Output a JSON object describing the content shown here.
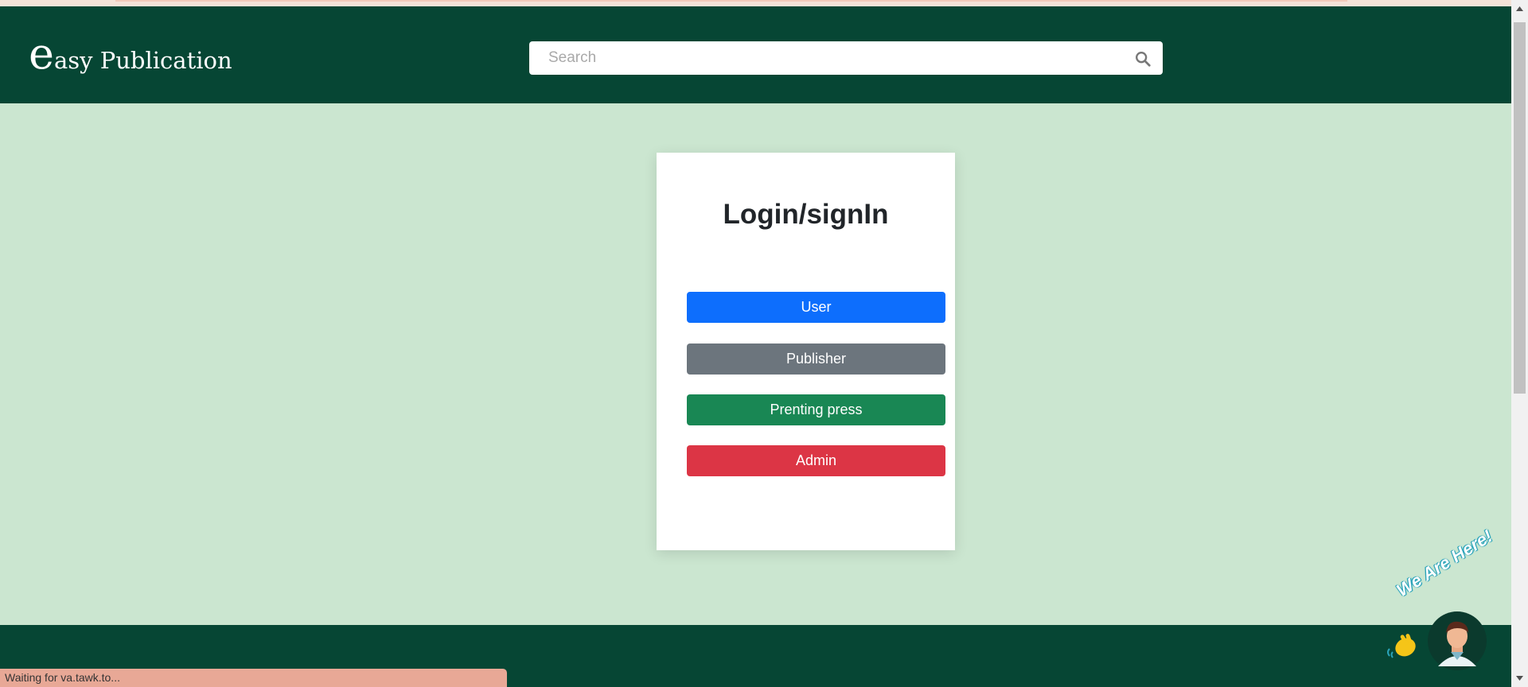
{
  "header": {
    "logo_initial": "e",
    "logo_rest": "asy Publication",
    "search": {
      "placeholder": "Search"
    }
  },
  "login": {
    "title": "Login/signIn",
    "buttons": {
      "user": "User",
      "publisher": "Publisher",
      "press": "Prenting press",
      "admin": "Admin"
    }
  },
  "status_bar": {
    "text": "Waiting for va.tawk.to..."
  },
  "chat_widget": {
    "tagline": "We Are Here!"
  },
  "colors": {
    "header_bg": "#064634",
    "page_bg": "#cbe6d0",
    "user": "#0d6efd",
    "publisher": "#6c757d",
    "press": "#198754",
    "admin": "#dc3545"
  }
}
